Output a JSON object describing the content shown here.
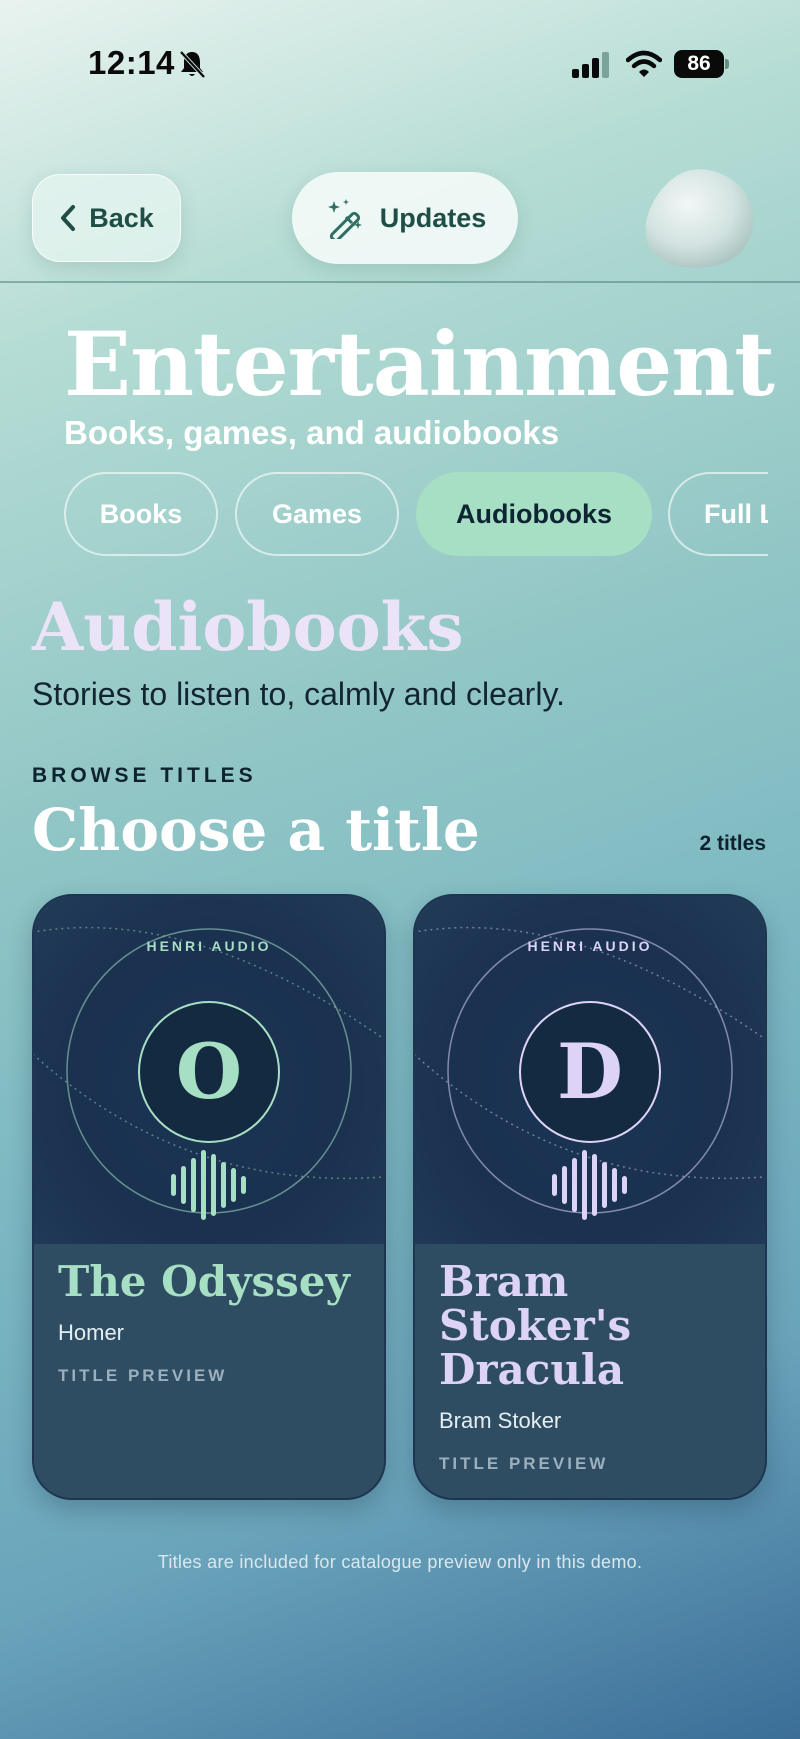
{
  "status_bar": {
    "time": "12:14",
    "battery": "86",
    "icons": [
      "bell-slash-icon",
      "cellular-signal-icon",
      "wifi-icon",
      "battery-icon"
    ]
  },
  "header": {
    "back_label": "Back",
    "updates_label": "Updates",
    "icons": [
      "chevron-left-icon",
      "magic-wand-icon",
      "pebble-avatar"
    ]
  },
  "page": {
    "title": "Entertainment",
    "subtitle": "Books, games, and audiobooks"
  },
  "tabs": [
    {
      "label": "Books",
      "active": false
    },
    {
      "label": "Games",
      "active": false
    },
    {
      "label": "Audiobooks",
      "active": true
    },
    {
      "label": "Full L",
      "active": false
    }
  ],
  "section": {
    "title": "Audiobooks",
    "description": "Stories to listen to, calmly and clearly."
  },
  "browse": {
    "eyebrow": "BROWSE TITLES",
    "title": "Choose a title",
    "count": "2 titles"
  },
  "cards": [
    {
      "publisher": "HENRI AUDIO",
      "monogram": "O",
      "title": "The Odyssey",
      "author": "Homer",
      "tag": "TITLE PREVIEW",
      "accent": "#a6dfc3"
    },
    {
      "publisher": "HENRI AUDIO",
      "monogram": "D",
      "title": "Bram Stoker's Dracula",
      "author": "Bram Stoker",
      "tag": "TITLE PREVIEW",
      "accent": "#ddd3f6"
    }
  ],
  "footnote": "Titles are included for catalogue preview only in this demo.",
  "colors": {
    "mint_accent": "#a6dfc3",
    "lavender_accent": "#ddd3f6",
    "card_navy": "#1a3150",
    "text_dark": "#0f2230"
  }
}
